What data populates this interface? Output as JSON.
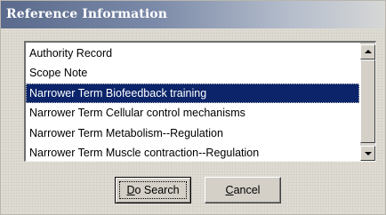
{
  "window": {
    "title": "Reference Information"
  },
  "list": {
    "items": [
      {
        "label": "Authority Record",
        "selected": false
      },
      {
        "label": "Scope Note",
        "selected": false
      },
      {
        "label": "Narrower Term Biofeedback training",
        "selected": true
      },
      {
        "label": "Narrower Term Cellular control mechanisms",
        "selected": false
      },
      {
        "label": "Narrower Term Metabolism--Regulation",
        "selected": false
      },
      {
        "label": "Narrower Term Muscle contraction--Regulation",
        "selected": false
      }
    ],
    "scroll": {
      "up_icon": "triangle-up",
      "down_icon": "triangle-down"
    }
  },
  "buttons": {
    "do_search": {
      "accel": "D",
      "rest": "o Search"
    },
    "cancel": {
      "accel": "C",
      "rest": "ancel"
    }
  },
  "colors": {
    "selection": "#0b246a",
    "title_gradient_start": "#5a6a8c",
    "title_gradient_end": "#d6d7d6"
  }
}
